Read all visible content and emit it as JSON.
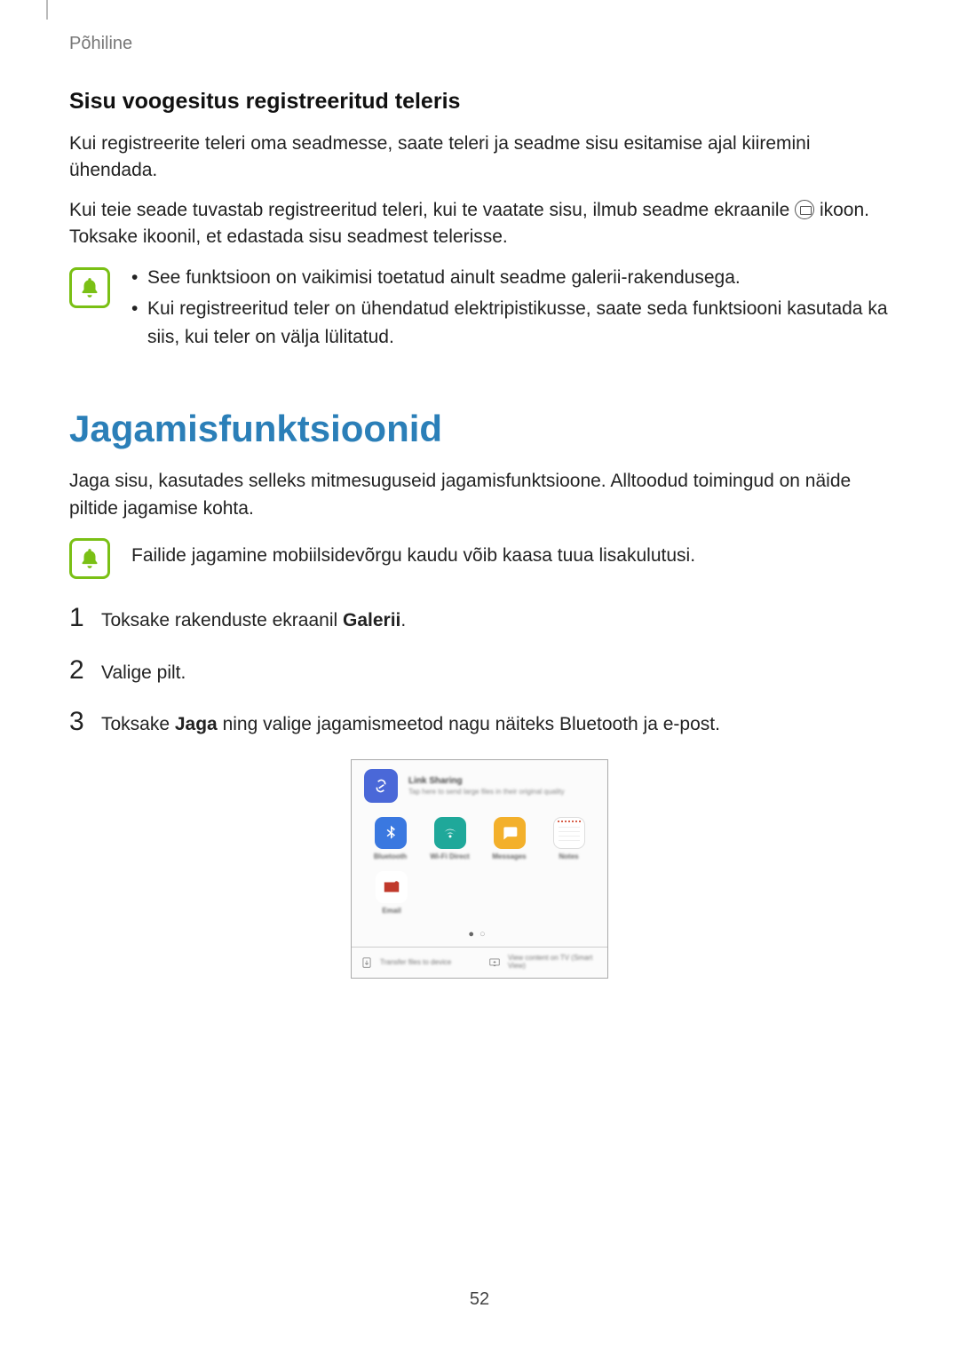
{
  "header": {
    "section": "Põhiline"
  },
  "section1": {
    "heading": "Sisu voogesitus registreeritud teleris",
    "para1": "Kui registreerite teleri oma seadmesse, saate teleri ja seadme sisu esitamise ajal kiiremini ühendada.",
    "para2_a": "Kui teie seade tuvastab registreeritud teleri, kui te vaatate sisu, ilmub seadme ekraanile ",
    "para2_b": " ikoon. Toksake ikoonil, et edastada sisu seadmest telerisse.",
    "notes": [
      "See funktsioon on vaikimisi toetatud ainult seadme galerii-rakendusega.",
      "Kui registreeritud teler on ühendatud elektripistikusse, saate seda funktsiooni kasutada ka siis, kui teler on välja lülitatud."
    ]
  },
  "section2": {
    "heading": "Jagamisfunktsioonid",
    "para": "Jaga sisu, kasutades selleks mitmesuguseid jagamisfunktsioone. Alltoodud toimingud on näide piltide jagamise kohta.",
    "note": "Failide jagamine mobiilsidevõrgu kaudu võib kaasa tuua lisakulutusi.",
    "steps": {
      "s1_a": "Toksake rakenduste ekraanil ",
      "s1_b": "Galerii",
      "s1_c": ".",
      "s2": "Valige pilt.",
      "s3_a": "Toksake ",
      "s3_b": "Jaga",
      "s3_c": " ning valige jagamismeetod nagu näiteks Bluetooth ja e-post."
    }
  },
  "figure": {
    "link_sharing_title": "Link Sharing",
    "link_sharing_sub": "Tap here to send large files in their original quality",
    "apps": {
      "bluetooth": "Bluetooth",
      "wifidirect": "Wi-Fi Direct",
      "messages": "Messages",
      "notes": "Notes",
      "email": "Email"
    },
    "bottom": {
      "transfer": "Transfer files to device",
      "view": "View content on TV (Smart View)"
    }
  },
  "pageNumber": "52",
  "bulletChar": "•"
}
